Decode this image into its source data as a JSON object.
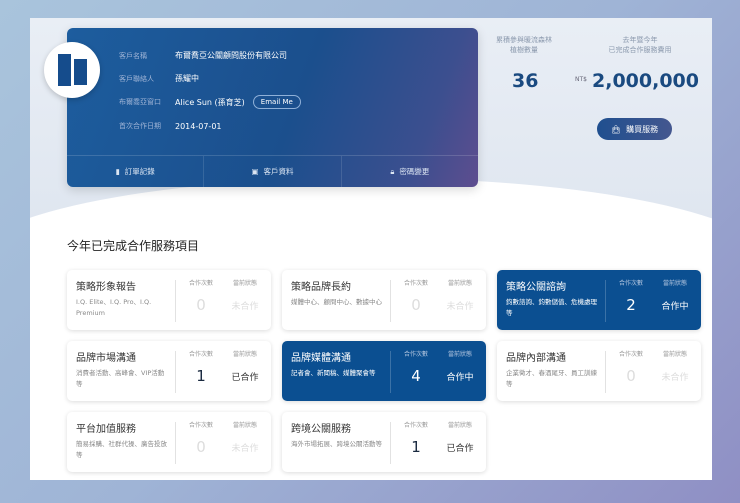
{
  "client": {
    "name_label": "客戶名稱",
    "name": "布爾喬亞公關顧問股份有限公司",
    "contact_label": "客戶聯絡人",
    "contact": "孫耀中",
    "window_label": "布爾喬亞窗口",
    "window": "Alice Sun (孫育芝)",
    "email_button": "Email Me",
    "date_label": "首次合作日期",
    "date": "2014-07-01"
  },
  "actions": [
    {
      "label": "訂單記錄",
      "icon": "clipboard-icon"
    },
    {
      "label": "客戶資料",
      "icon": "id-card-icon"
    },
    {
      "label": "密碼變更",
      "icon": "lock-icon"
    }
  ],
  "stats": {
    "trees_label_1": "累積參與暖流森林",
    "trees_label_2": "植樹數量",
    "trees": "36",
    "fee_label_1": "去年暨今年",
    "fee_label_2": "已完成合作服務費用",
    "currency": "NT$",
    "fee": "2,000,000",
    "buy_button": "購買服務"
  },
  "section_title": "今年已完成合作服務項目",
  "count_header": "合作次數",
  "status_header": "當前狀態",
  "services": [
    {
      "title": "策略形象報告",
      "desc": "I.Q. Elite、I.Q. Pro、I.Q. Premium",
      "count": "0",
      "status": "未合作",
      "state": "off"
    },
    {
      "title": "策略品牌長約",
      "desc": "媒體中心、顧問中心、數據中心",
      "count": "0",
      "status": "未合作",
      "state": "off"
    },
    {
      "title": "策略公關諮詢",
      "desc": "鈞數諮詢、鈞數儲值、危機處理等",
      "count": "2",
      "status": "合作中",
      "state": "on"
    },
    {
      "title": "品牌市場溝通",
      "desc": "消費者活動、高峰會、VIP活動等",
      "count": "1",
      "status": "已合作",
      "state": "done"
    },
    {
      "title": "品牌媒體溝通",
      "desc": "記者會、新聞稿、媒體聚會等",
      "count": "4",
      "status": "合作中",
      "state": "on"
    },
    {
      "title": "品牌內部溝通",
      "desc": "企業徵才、春酒尾牙、員工訓練等",
      "count": "0",
      "status": "未合作",
      "state": "off"
    },
    {
      "title": "平台加值服務",
      "desc": "簡易採購、社群代操、廣告投放等",
      "count": "0",
      "status": "未合作",
      "state": "off"
    },
    {
      "title": "跨境公關服務",
      "desc": "海外市場拓展、跨境公關活動等",
      "count": "1",
      "status": "已合作",
      "state": "done"
    }
  ]
}
